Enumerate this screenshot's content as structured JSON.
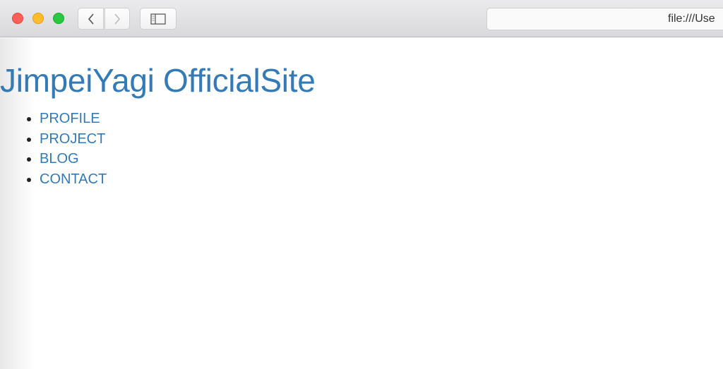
{
  "browser": {
    "window_controls": {
      "close_color": "#fe5f57",
      "minimize_color": "#febc2e",
      "maximize_color": "#28c840"
    },
    "back_icon": "chevron-left-icon",
    "forward_icon": "chevron-right-icon",
    "sidebar_icon": "sidebar-icon",
    "address": "file:///Use"
  },
  "page": {
    "title": "JimpeiYagi OfficialSite",
    "accent": "#337ab7",
    "nav": [
      {
        "label": "PROFILE"
      },
      {
        "label": "PROJECT"
      },
      {
        "label": "BLOG"
      },
      {
        "label": "CONTACT"
      }
    ]
  }
}
